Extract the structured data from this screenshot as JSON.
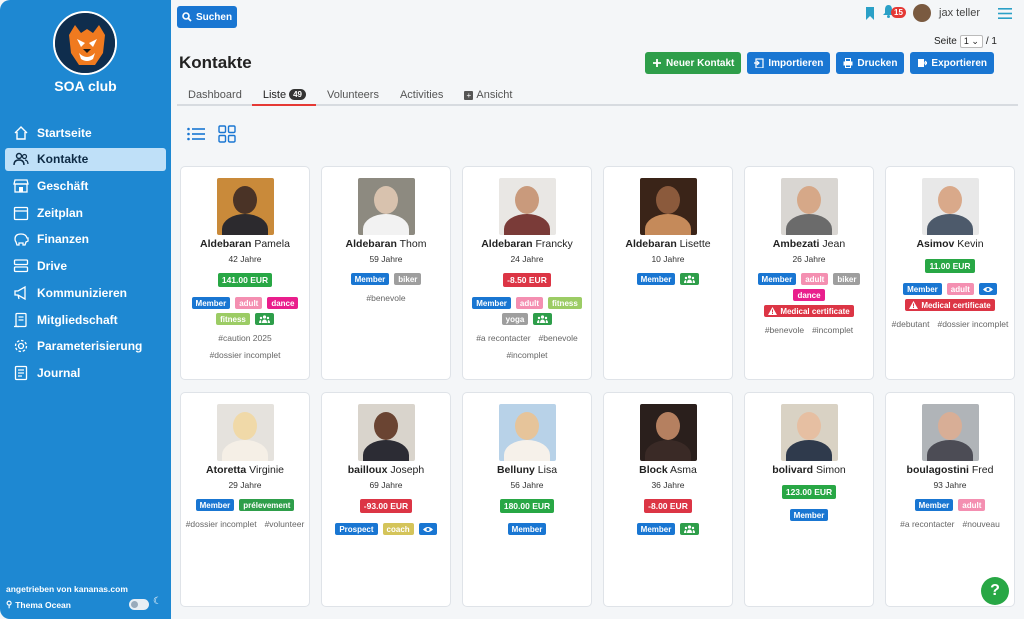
{
  "club": {
    "name": "SOA club"
  },
  "sidebar": {
    "items": [
      {
        "label": "Startseite",
        "icon": "home-icon",
        "active": false
      },
      {
        "label": "Kontakte",
        "icon": "users-icon",
        "active": true
      },
      {
        "label": "Geschäft",
        "icon": "shop-icon",
        "active": false
      },
      {
        "label": "Zeitplan",
        "icon": "calendar-icon",
        "active": false
      },
      {
        "label": "Finanzen",
        "icon": "piggy-bank-icon",
        "active": false
      },
      {
        "label": "Drive",
        "icon": "drive-icon",
        "active": false
      },
      {
        "label": "Kommunizieren",
        "icon": "megaphone-icon",
        "active": false
      },
      {
        "label": "Mitgliedschaft",
        "icon": "membership-icon",
        "active": false
      },
      {
        "label": "Parameterisierung",
        "icon": "gear-icon",
        "active": false
      },
      {
        "label": "Journal",
        "icon": "journal-icon",
        "active": false
      }
    ],
    "powered_by": "angetrieben von kananas.com",
    "theme_label": "Thema Ocean"
  },
  "topbar": {
    "search_label": "Suchen",
    "notifications_count": "15",
    "user_name": "jax teller",
    "page_label": "Seite",
    "page_value": "1",
    "page_total": "/ 1"
  },
  "page": {
    "title": "Kontakte",
    "actions": [
      {
        "label": "Neuer Kontakt",
        "color": "#2e9e4a",
        "icon": "plus-icon"
      },
      {
        "label": "Importieren",
        "color": "#1976d2",
        "icon": "import-icon"
      },
      {
        "label": "Drucken",
        "color": "#1976d2",
        "icon": "print-icon"
      },
      {
        "label": "Exportieren",
        "color": "#1976d2",
        "icon": "export-icon"
      }
    ],
    "tabs": [
      {
        "label": "Dashboard",
        "count": "",
        "active": false
      },
      {
        "label": "Liste",
        "count": "49",
        "active": true
      },
      {
        "label": "Volunteers",
        "count": "",
        "active": false
      },
      {
        "label": "Activities",
        "count": "",
        "active": false
      },
      {
        "label": "Ansicht",
        "count": "",
        "active": false
      }
    ]
  },
  "tag_colors": {
    "Member": "#1976d2",
    "adult": "#f48fb1",
    "dance": "#e91e8c",
    "fitness": "#9ccc65",
    "biker": "#9e9e9e",
    "yoga": "#9e9e9e",
    "prélevement": "#2e9e4a",
    "Prospect": "#1976d2",
    "coach": "#d4c45a",
    "group": "#2e9e4a",
    "eye": "#1976d2",
    "Medical certificate": "#dc3545"
  },
  "contacts": [
    {
      "last": "Aldebaran",
      "first": "Pamela",
      "age": "42 Jahre",
      "balance": "141.00 EUR",
      "balance_type": "pos",
      "photo": [
        "#c98a3a",
        "#4a3326",
        "#2c2a2e"
      ],
      "tags": [
        "Member",
        "adult",
        "dance",
        "fitness",
        "group"
      ],
      "hashtags": [
        "#caution 2025",
        "#dossier incomplet"
      ]
    },
    {
      "last": "Aldebaran",
      "first": "Thom",
      "age": "59 Jahre",
      "balance": "",
      "balance_type": "",
      "photo": [
        "#8d8a80",
        "#d8c2ae",
        "#f2f2f2"
      ],
      "tags": [
        "Member",
        "biker"
      ],
      "hashtags": [
        "#benevole"
      ]
    },
    {
      "last": "Aldebaran",
      "first": "Francky",
      "age": "24 Jahre",
      "balance": "-8.50 EUR",
      "balance_type": "neg",
      "photo": [
        "#e9e7e4",
        "#c99a7c",
        "#7a3b38"
      ],
      "tags": [
        "Member",
        "adult",
        "fitness",
        "yoga",
        "group"
      ],
      "hashtags": [
        "#a recontacter",
        "#benevole",
        "#incomplet"
      ]
    },
    {
      "last": "Aldebaran",
      "first": "Lisette",
      "age": "10 Jahre",
      "balance": "",
      "balance_type": "",
      "photo": [
        "#3a2418",
        "#8b5a3c",
        "#c58a5a"
      ],
      "tags": [
        "Member",
        "group"
      ],
      "hashtags": []
    },
    {
      "last": "Ambezati",
      "first": "Jean",
      "age": "26 Jahre",
      "balance": "",
      "balance_type": "",
      "photo": [
        "#d9d6d2",
        "#d6a888",
        "#6b6b6b"
      ],
      "tags": [
        "Member",
        "adult",
        "biker",
        "dance",
        "Medical certificate"
      ],
      "hashtags": [
        "#benevole",
        "#incomplet"
      ]
    },
    {
      "last": "Asimov",
      "first": "Kevin",
      "age": "",
      "balance": "11.00 EUR",
      "balance_type": "pos",
      "photo": [
        "#e8e8e8",
        "#d9a98a",
        "#4d5a6b"
      ],
      "tags": [
        "Member",
        "adult",
        "eye",
        "Medical certificate"
      ],
      "hashtags": [
        "#debutant",
        "#dossier incomplet"
      ]
    },
    {
      "last": "Atoretta",
      "first": "Virginie",
      "age": "29 Jahre",
      "balance": "",
      "balance_type": "",
      "photo": [
        "#e5e2dd",
        "#f0d9a8",
        "#f5efe6"
      ],
      "tags": [
        "Member",
        "prélevement"
      ],
      "hashtags": [
        "#dossier incomplet",
        "#volunteer"
      ]
    },
    {
      "last": "bailloux",
      "first": "Joseph",
      "age": "69 Jahre",
      "balance": "-93.00 EUR",
      "balance_type": "neg",
      "photo": [
        "#d9d4cc",
        "#6a4432",
        "#2c2c34"
      ],
      "tags": [
        "Prospect",
        "coach",
        "eye"
      ],
      "hashtags": []
    },
    {
      "last": "Belluny",
      "first": "Lisa",
      "age": "56 Jahre",
      "balance": "180.00 EUR",
      "balance_type": "pos",
      "photo": [
        "#b8d2e8",
        "#e6c49a",
        "#f6f1ea"
      ],
      "tags": [
        "Member"
      ],
      "hashtags": []
    },
    {
      "last": "Block",
      "first": "Asma",
      "age": "36 Jahre",
      "balance": "-8.00 EUR",
      "balance_type": "neg",
      "photo": [
        "#2a1f1c",
        "#b58060",
        "#3a2a26"
      ],
      "tags": [
        "Member",
        "group"
      ],
      "hashtags": []
    },
    {
      "last": "bolivard",
      "first": "Simon",
      "age": "",
      "balance": "123.00 EUR",
      "balance_type": "pos",
      "photo": [
        "#d9d2c4",
        "#e6bfa2",
        "#2f3a4c"
      ],
      "tags": [
        "Member"
      ],
      "hashtags": []
    },
    {
      "last": "boulagostini",
      "first": "Fred",
      "age": "93 Jahre",
      "balance": "",
      "balance_type": "",
      "photo": [
        "#b0b4b8",
        "#d8ae96",
        "#4c4c55"
      ],
      "tags": [
        "Member",
        "adult"
      ],
      "hashtags": [
        "#a recontacter",
        "#nouveau"
      ]
    }
  ]
}
